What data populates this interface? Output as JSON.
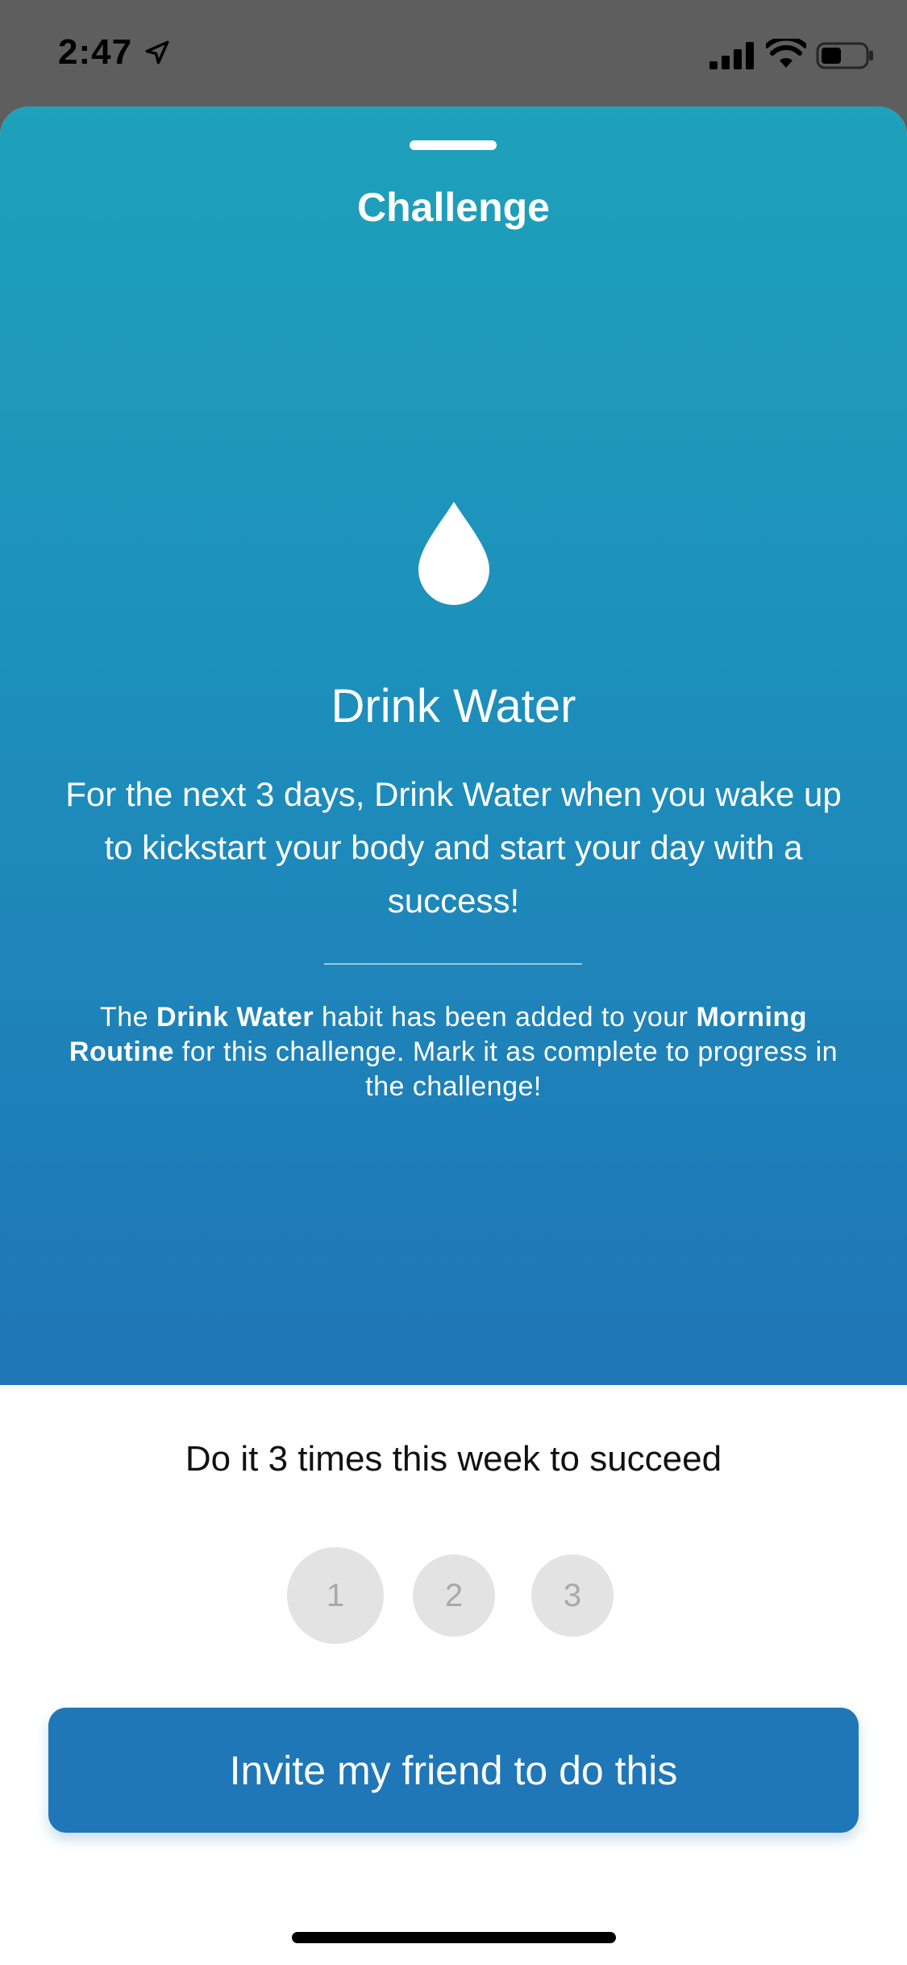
{
  "status_bar": {
    "time": "2:47"
  },
  "sheet": {
    "title": "Challenge"
  },
  "habit": {
    "name": "Drink Water",
    "description": "For the next 3 days, Drink Water when you wake up to kickstart your body and start your day with a success!",
    "note": {
      "part1": "The ",
      "bold1": "Drink Water",
      "part2": " habit has been added to your ",
      "bold2": "Morning Routine",
      "part3": " for this challenge. Mark it as complete to progress in the challenge!"
    }
  },
  "goal": {
    "text": "Do it 3 times this week to succeed",
    "days": [
      "1",
      "2",
      "3"
    ]
  },
  "invite_button": {
    "label": "Invite my friend to do this"
  },
  "colors": {
    "gradient_top": "#1ea1bb",
    "gradient_bottom": "#1f75b6",
    "button": "#1f77b7",
    "day_circle": "#e3e3e3"
  },
  "icons": [
    "location-arrow-icon",
    "signal-icon",
    "wifi-icon",
    "battery-icon",
    "water-drop-icon"
  ]
}
